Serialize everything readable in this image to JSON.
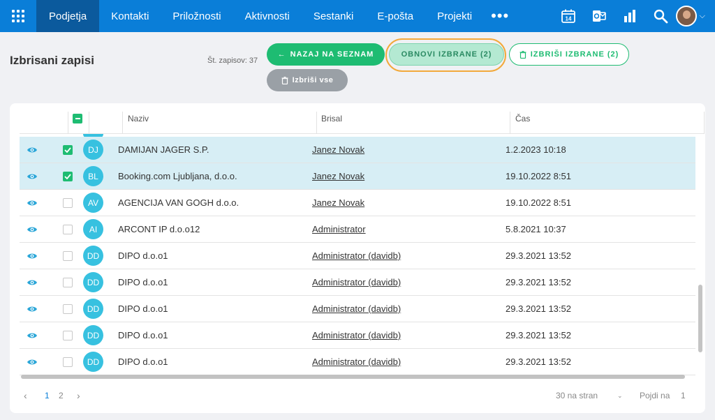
{
  "nav": {
    "items": [
      "Podjetja",
      "Kontakti",
      "Priložnosti",
      "Aktivnosti",
      "Sestanki",
      "E-pošta",
      "Projekti"
    ],
    "more": "•••",
    "calendar_day": "14"
  },
  "header": {
    "title": "Izbrisani zapisi",
    "count_label": "Št. zapisov: 37",
    "back_label": "NAZAJ NA SEZNAM",
    "restore_label": "OBNOVI IZBRANE (2)",
    "delete_selected_label": "IZBRIŠI IZBRANE (2)",
    "delete_all_label": "Izbriši vse"
  },
  "table": {
    "columns": [
      "Naziv",
      "Brisal",
      "Čas"
    ],
    "rows": [
      {
        "initials": "DJ",
        "name": "DAMIJAN JAGER S.P.",
        "deleted_by": "Janez Novak",
        "time": "1.2.2023 10:18",
        "checked": true
      },
      {
        "initials": "BL",
        "name": "Booking.com Ljubljana, d.o.o.",
        "deleted_by": "Janez Novak",
        "time": "19.10.2022 8:51",
        "checked": true
      },
      {
        "initials": "AV",
        "name": "AGENCIJA VAN GOGH d.o.o.",
        "deleted_by": "Janez Novak",
        "time": "19.10.2022 8:51",
        "checked": false
      },
      {
        "initials": "AI",
        "name": "ARCONT IP d.o.o12",
        "deleted_by": "Administrator",
        "time": "5.8.2021 10:37",
        "checked": false
      },
      {
        "initials": "DD",
        "name": "DIPO d.o.o1",
        "deleted_by": "Administrator (davidb)",
        "time": "29.3.2021 13:52",
        "checked": false
      },
      {
        "initials": "DD",
        "name": "DIPO d.o.o1",
        "deleted_by": "Administrator (davidb)",
        "time": "29.3.2021 13:52",
        "checked": false
      },
      {
        "initials": "DD",
        "name": "DIPO d.o.o1",
        "deleted_by": "Administrator (davidb)",
        "time": "29.3.2021 13:52",
        "checked": false
      },
      {
        "initials": "DD",
        "name": "DIPO d.o.o1",
        "deleted_by": "Administrator (davidb)",
        "time": "29.3.2021 13:52",
        "checked": false
      },
      {
        "initials": "DD",
        "name": "DIPO d.o.o1",
        "deleted_by": "Administrator (davidb)",
        "time": "29.3.2021 13:52",
        "checked": false
      }
    ]
  },
  "pagination": {
    "pages": [
      "1",
      "2"
    ],
    "per_page": "30 na stran",
    "goto_label": "Pojdi na",
    "goto_value": "1"
  },
  "colors": {
    "nav_bg": "#0a7ed8",
    "nav_active": "#0b5a9d",
    "accent_green": "#1ebc72",
    "avatar": "#37c1e0",
    "selected_row": "#d7eef5",
    "highlight_ring": "#f2a93b"
  }
}
